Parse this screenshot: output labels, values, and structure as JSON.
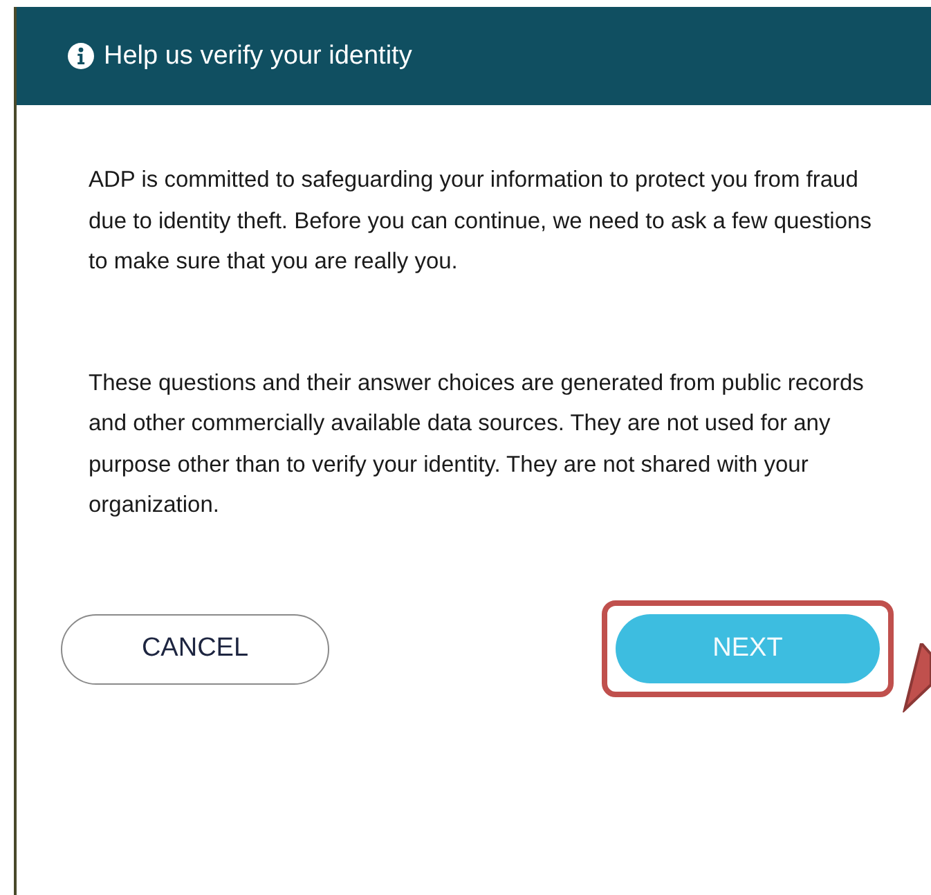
{
  "dialog": {
    "title": "Help us verify your identity"
  },
  "paragraphs": [
    "ADP is committed to safeguarding your information to protect you from fraud due to identity theft. Before you can continue, we need to ask a few questions to make sure that you are really you.",
    "These questions and their answer choices are generated from public records and other commercially available data sources. They are not used for any purpose other than to verify your identity. They are not shared with your organization."
  ],
  "buttons": [
    {
      "label": "CANCEL",
      "kind": "secondary",
      "highlighted": false
    },
    {
      "label": "NEXT",
      "kind": "primary",
      "highlighted": true
    }
  ]
}
